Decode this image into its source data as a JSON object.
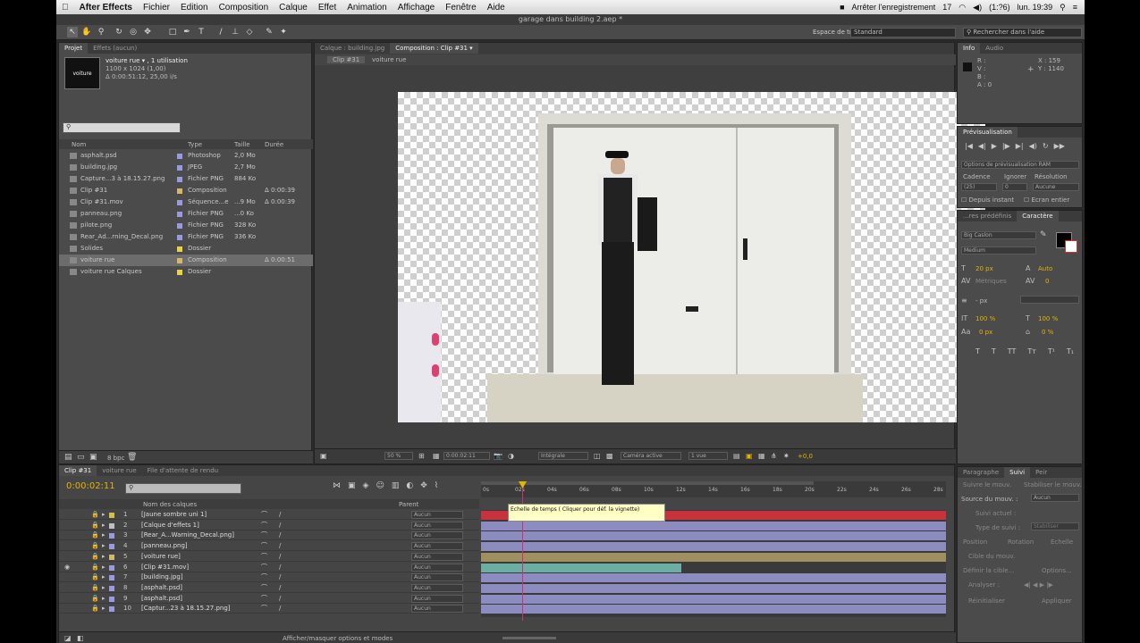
{
  "menubar": {
    "apple": "",
    "app": "After Effects",
    "items": [
      "Fichier",
      "Edition",
      "Composition",
      "Calque",
      "Effet",
      "Animation",
      "Affichage",
      "Fenêtre",
      "Aide"
    ],
    "recording": "Arrêter l'enregistrement",
    "calendar": "17",
    "battery": "(1:?6)",
    "clock": "lun. 19:39"
  },
  "window_title": "garage dans building 2.aep *",
  "toolbar": {
    "workspace_label": "Espace de travail :",
    "workspace_value": "Standard",
    "help_search": "Rechercher dans l'aide"
  },
  "project": {
    "tabs": [
      "Projet",
      "Effets (aucun)"
    ],
    "item_name": "voiture rue ▾ , 1 utilisation",
    "item_size": "1100 x 1024 (1,00)",
    "item_duration": "Δ 0:00:51:12, 25,00 i/s",
    "thumb_text": "voiture",
    "search_placeholder": "",
    "columns": [
      "Nom",
      "Type",
      "Taille",
      "Durée"
    ],
    "items": [
      {
        "name": "asphalt.psd",
        "color": "#9a9ae0",
        "type": "Photoshop",
        "size": "2,0 Mo",
        "dur": ""
      },
      {
        "name": "building.jpg",
        "color": "#9a9ae0",
        "type": "JPEG",
        "size": "2,7 Mo",
        "dur": ""
      },
      {
        "name": "Capture...3 à 18.15.27.png",
        "color": "#9a9ae0",
        "type": "Fichier PNG",
        "size": "884 Ko",
        "dur": ""
      },
      {
        "name": "Clip #31",
        "color": "#d4b86a",
        "type": "Composition",
        "size": "",
        "dur": "Δ 0:00:39"
      },
      {
        "name": "Clip #31.mov",
        "color": "#9a9ae0",
        "type": "Séquence...e",
        "size": "...9 Mo",
        "dur": "Δ 0:00:39"
      },
      {
        "name": "panneau.png",
        "color": "#9a9ae0",
        "type": "Fichier PNG",
        "size": "...0 Ko",
        "dur": ""
      },
      {
        "name": "pilote.png",
        "color": "#9a9ae0",
        "type": "Fichier PNG",
        "size": "328 Ko",
        "dur": ""
      },
      {
        "name": "Rear_Ad...rning_Decal.png",
        "color": "#9a9ae0",
        "type": "Fichier PNG",
        "size": "336 Ko",
        "dur": ""
      },
      {
        "name": "Solides",
        "color": "#e6d34a",
        "type": "Dossier",
        "size": "",
        "dur": ""
      },
      {
        "name": "voiture rue",
        "color": "#d4b86a",
        "type": "Composition",
        "size": "",
        "dur": "Δ 0:00:51"
      },
      {
        "name": "voiture rue Calques",
        "color": "#e6d34a",
        "type": "Dossier",
        "size": "",
        "dur": ""
      }
    ],
    "bpc": "8 bpc"
  },
  "composition": {
    "tabs": [
      "Calque : building.jpg",
      "Composition : Clip #31 ▾"
    ],
    "crumbs": [
      "Clip #31",
      "voiture rue"
    ],
    "zoom": "50 %",
    "timecode": "0:00:02:11",
    "resolution": "Intégrale",
    "camera": "Caméra active",
    "views": "1 vue",
    "exposure": "+0,0"
  },
  "info": {
    "tabs": [
      "Info",
      "Audio"
    ],
    "r": "R :",
    "g": "V :",
    "b": "B :",
    "a": "A : 0",
    "x": "X : 159",
    "y": "Y : 1140"
  },
  "preview": {
    "title": "Prévisualisation",
    "options_label": "Options de prévisualisation RAM",
    "cadence_label": "Cadence",
    "ignore_label": "Ignorer",
    "resolution_label": "Résolution",
    "cadence": "(25)",
    "ignore": "0",
    "resolution": "Aucune",
    "from_current": "Depuis instant",
    "fullscreen": "Ecran entier"
  },
  "character": {
    "tabs": [
      "...res prédéfinis",
      "Caractère"
    ],
    "font": "Big Caslon",
    "style": "Medium",
    "size": "20 px",
    "leading": "Auto",
    "kerning": "Métriques",
    "tracking": "0",
    "stroke": "- px",
    "vscale": "100 %",
    "hscale": "100 %",
    "baseline": "0 px",
    "tsume": "0 %"
  },
  "tracker": {
    "tabs": [
      "Paragraphe",
      "Suivi",
      "Peir"
    ],
    "motion_source_label": "Source du mouv. :",
    "motion_source": "Aucun",
    "track_motion": "Suivre le mouv.",
    "stabilize": "Stabiliser le mouv.",
    "current_track": "Suivi actuel :",
    "track_type": "Type de suivi :",
    "stabilize_value": "Stabiliser",
    "position": "Position",
    "rotation": "Rotation",
    "scale": "Echelle",
    "motion_target": "Cible du mouv.",
    "define_target": "Définir la cible...",
    "options": "Options...",
    "analyze": "Analyser :",
    "reset": "Réinitialiser",
    "apply": "Appliquer"
  },
  "timeline": {
    "tabs": [
      "Clip #31",
      "voiture rue",
      "File d'attente de rendu"
    ],
    "timecode": "0:00:02:11",
    "search_placeholder": "",
    "col_name": "Nom des calques",
    "col_parent": "Parent",
    "ruler": [
      "0s",
      "02s",
      "04s",
      "06s",
      "08s",
      "10s",
      "12s",
      "14s",
      "16s",
      "18s",
      "20s",
      "22s",
      "24s",
      "26s",
      "28s"
    ],
    "tooltip": "Echelle de temps ( Cliquer pour déf. la vignette)",
    "footer": "Afficher/masquer options et modes",
    "layers": [
      {
        "num": "1",
        "name": "[Jaune sombre uni 1]",
        "color": "#d0c04a",
        "parent": "Aucun",
        "bar": "#c8323c",
        "start": 0,
        "end": 1
      },
      {
        "num": "2",
        "name": "[Calque d'effets 1]",
        "color": "#c0c0c0",
        "parent": "Aucun",
        "bar": "#8c8cc0",
        "start": 0,
        "end": 1
      },
      {
        "num": "3",
        "name": "[Rear_A...Warning_Decal.png]",
        "color": "#9a9ae0",
        "parent": "Aucun",
        "bar": "#8c8cc0",
        "start": 0,
        "end": 1
      },
      {
        "num": "4",
        "name": "[panneau.png]",
        "color": "#9a9ae0",
        "parent": "Aucun",
        "bar": "#8c8cc0",
        "start": 0,
        "end": 1
      },
      {
        "num": "5",
        "name": "[voiture rue]",
        "color": "#d4b86a",
        "parent": "Aucun",
        "bar": "#a09060",
        "start": 0,
        "end": 1
      },
      {
        "num": "6",
        "name": "[Clip #31.mov]",
        "color": "#9a9ae0",
        "parent": "Aucun",
        "bar": "#6aaea4",
        "start": 0,
        "end": 0.43
      },
      {
        "num": "7",
        "name": "[building.jpg]",
        "color": "#9a9ae0",
        "parent": "Aucun",
        "bar": "#8c8cc0",
        "start": 0,
        "end": 1
      },
      {
        "num": "8",
        "name": "[asphalt.psd]",
        "color": "#9a9ae0",
        "parent": "Aucun",
        "bar": "#8c8cc0",
        "start": 0,
        "end": 1
      },
      {
        "num": "9",
        "name": "[asphalt.psd]",
        "color": "#9a9ae0",
        "parent": "Aucun",
        "bar": "#8c8cc0",
        "start": 0,
        "end": 1
      },
      {
        "num": "10",
        "name": "[Captur...23 à 18.15.27.png]",
        "color": "#9a9ae0",
        "parent": "Aucun",
        "bar": "#8c8cc0",
        "start": 0,
        "end": 1
      }
    ]
  },
  "colors": {
    "accent": "#e3b400",
    "panel": "#4b4b4b",
    "label_red": "#c8323c",
    "playhead": "#d03070"
  }
}
